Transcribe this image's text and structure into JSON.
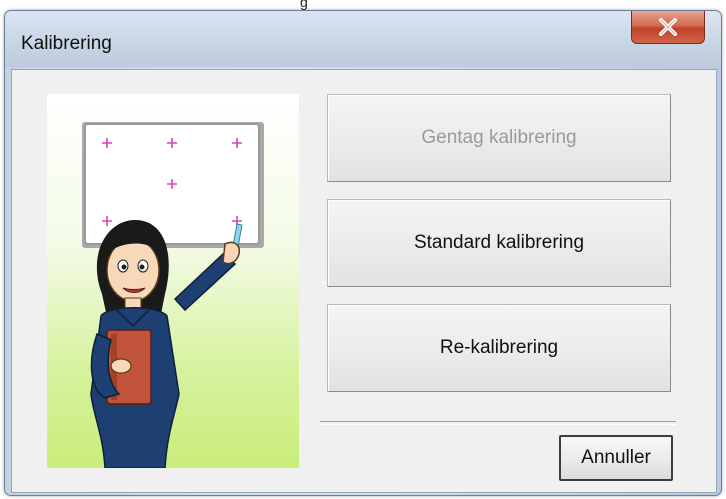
{
  "top_partial_title": "g",
  "window": {
    "title": "Kalibrering",
    "close_label": "x"
  },
  "buttons": {
    "repeat": {
      "label": "Gentag kalibrering",
      "enabled": false
    },
    "standard": {
      "label": "Standard kalibrering",
      "enabled": true
    },
    "recalibrate": {
      "label": "Re-kalibrering",
      "enabled": true
    },
    "cancel": {
      "label": "Annuller",
      "enabled": true
    }
  },
  "illustration": {
    "icon": "calibration-illustration-icon",
    "marker_color": "#e040c0",
    "marker_glyph": "+"
  },
  "colors": {
    "close_button": "#c8472f",
    "disabled_text": "#9a9a9a"
  }
}
